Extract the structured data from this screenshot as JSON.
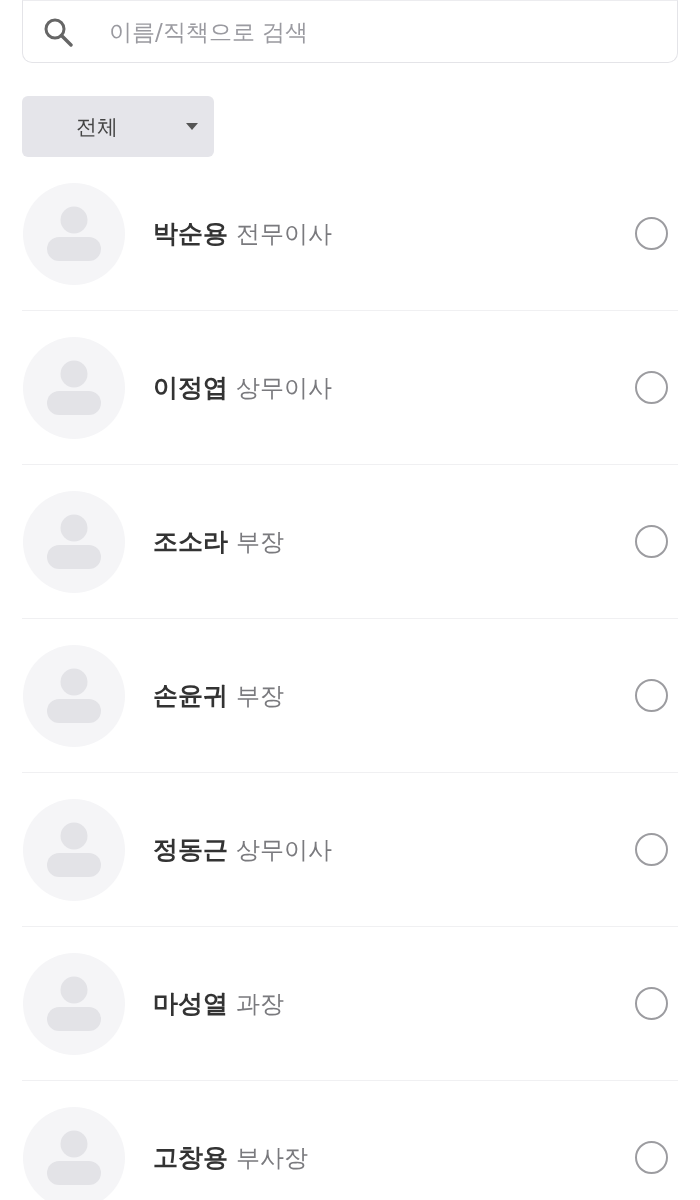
{
  "search": {
    "placeholder": "이름/직책으로 검색"
  },
  "filter": {
    "label": "전체"
  },
  "people": [
    {
      "name": "박순용",
      "title": "전무이사",
      "selected": false
    },
    {
      "name": "이정엽",
      "title": "상무이사",
      "selected": false
    },
    {
      "name": "조소라",
      "title": "부장",
      "selected": false
    },
    {
      "name": "손윤귀",
      "title": "부장",
      "selected": false
    },
    {
      "name": "정동근",
      "title": "상무이사",
      "selected": false
    },
    {
      "name": "마성열",
      "title": "과장",
      "selected": false
    },
    {
      "name": "고창용",
      "title": "부사장",
      "selected": false
    }
  ]
}
